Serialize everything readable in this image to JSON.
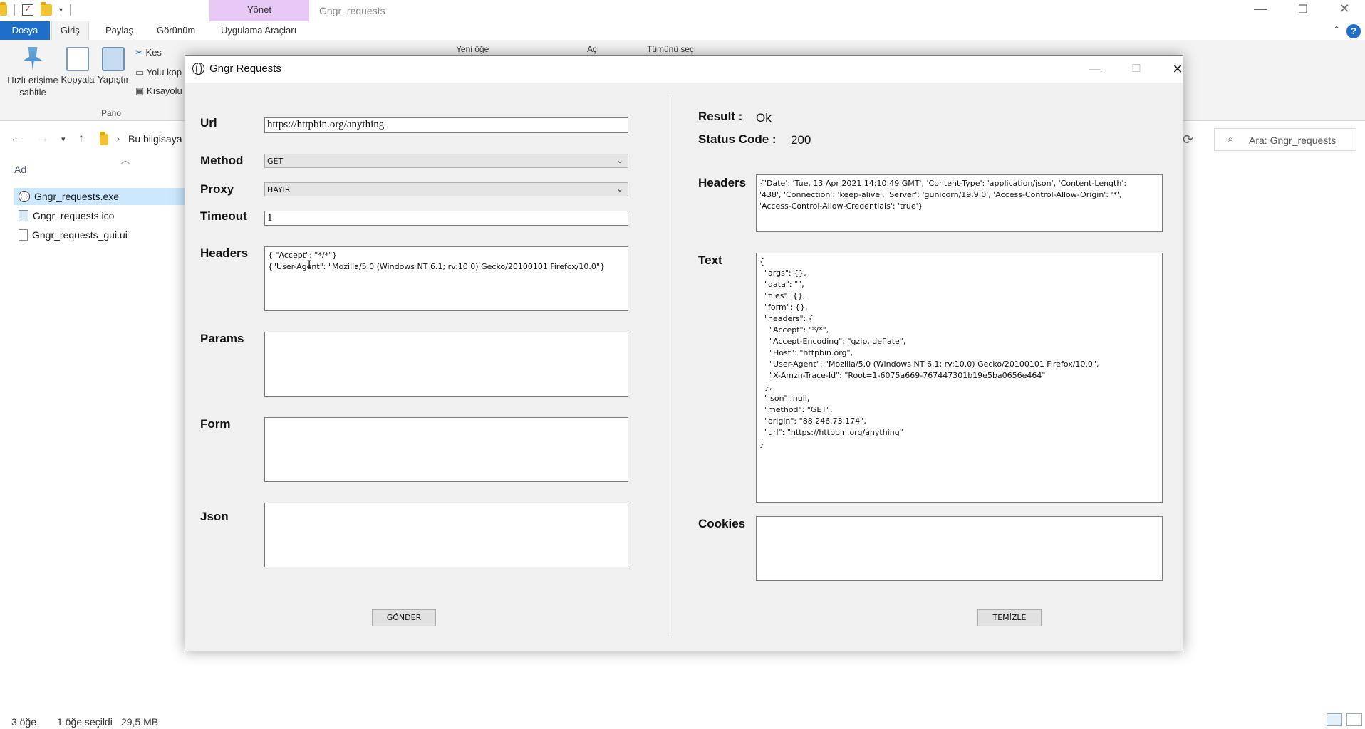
{
  "explorer": {
    "window_title": "Gngr_requests",
    "context_tab": "Yönet",
    "tabs": [
      "Dosya",
      "Giriş",
      "Paylaş",
      "Görünüm",
      "Uygulama Araçları"
    ],
    "ribbon": {
      "pin_label": "Hızlı erişime sabitle",
      "copy_label": "Kopyala",
      "paste_label": "Yapıştır",
      "cut_label": "Kes",
      "copy_path_label": "Yolu kop",
      "shortcut_label": "Kısayolu",
      "group_label": "Pano",
      "new_item_label": "Yeni öğe",
      "open_label": "Aç",
      "select_all_label": "Tümünü seç"
    },
    "address": "Bu bilgisaya",
    "search_placeholder": "Ara: Gngr_requests",
    "column_header": "Ad",
    "files": [
      {
        "name": "Gngr_requests.exe"
      },
      {
        "name": "Gngr_requests.ico"
      },
      {
        "name": "Gngr_requests_gui.ui"
      }
    ],
    "status": {
      "count": "3 öğe",
      "selected": "1 öğe seçildi",
      "size": "29,5 MB"
    }
  },
  "dialog": {
    "title": "Gngr Requests",
    "left": {
      "url_label": "Url",
      "url_value": "https://httpbin.org/anything",
      "method_label": "Method",
      "method_value": "GET",
      "proxy_label": "Proxy",
      "proxy_value": "HAYIR",
      "timeout_label": "Timeout",
      "timeout_value": "1",
      "headers_label": "Headers",
      "headers_value": "{ \"Accept\": \"*/*\"}\n{\"User-Agent\": \"Mozilla/5.0 (Windows NT 6.1; rv:10.0) Gecko/20100101 Firefox/10.0\"}",
      "params_label": "Params",
      "params_value": "",
      "form_label": "Form",
      "form_value": "",
      "json_label": "Json",
      "json_value": "",
      "send_button": "GÖNDER"
    },
    "right": {
      "result_label": "Result :",
      "result_value": "Ok",
      "status_label": "Status Code :",
      "status_value": "200",
      "headers_label": "Headers",
      "headers_value": "{'Date': 'Tue, 13 Apr 2021 14:10:49 GMT', 'Content-Type': 'application/json', 'Content-Length':\n'438', 'Connection': 'keep-alive', 'Server': 'gunicorn/19.9.0', 'Access-Control-Allow-Origin': '*',\n'Access-Control-Allow-Credentials': 'true'}",
      "text_label": "Text",
      "text_value": "{\n  \"args\": {},\n  \"data\": \"\",\n  \"files\": {},\n  \"form\": {},\n  \"headers\": {\n    \"Accept\": \"*/*\",\n    \"Accept-Encoding\": \"gzip, deflate\",\n    \"Host\": \"httpbin.org\",\n    \"User-Agent\": \"Mozilla/5.0 (Windows NT 6.1; rv:10.0) Gecko/20100101 Firefox/10.0\",\n    \"X-Amzn-Trace-Id\": \"Root=1-6075a669-767447301b19e5ba0656e464\"\n  },\n  \"json\": null,\n  \"method\": \"GET\",\n  \"origin\": \"88.246.73.174\",\n  \"url\": \"https://httpbin.org/anything\"\n}",
      "cookies_label": "Cookies",
      "cookies_value": "",
      "clear_button": "TEMİZLE"
    }
  },
  "colors": {
    "file_tab": "#1e6ec9",
    "context_tab": "#e8c9f5",
    "selection": "#cce8ff",
    "dialog_bg": "#f0f0f0"
  }
}
